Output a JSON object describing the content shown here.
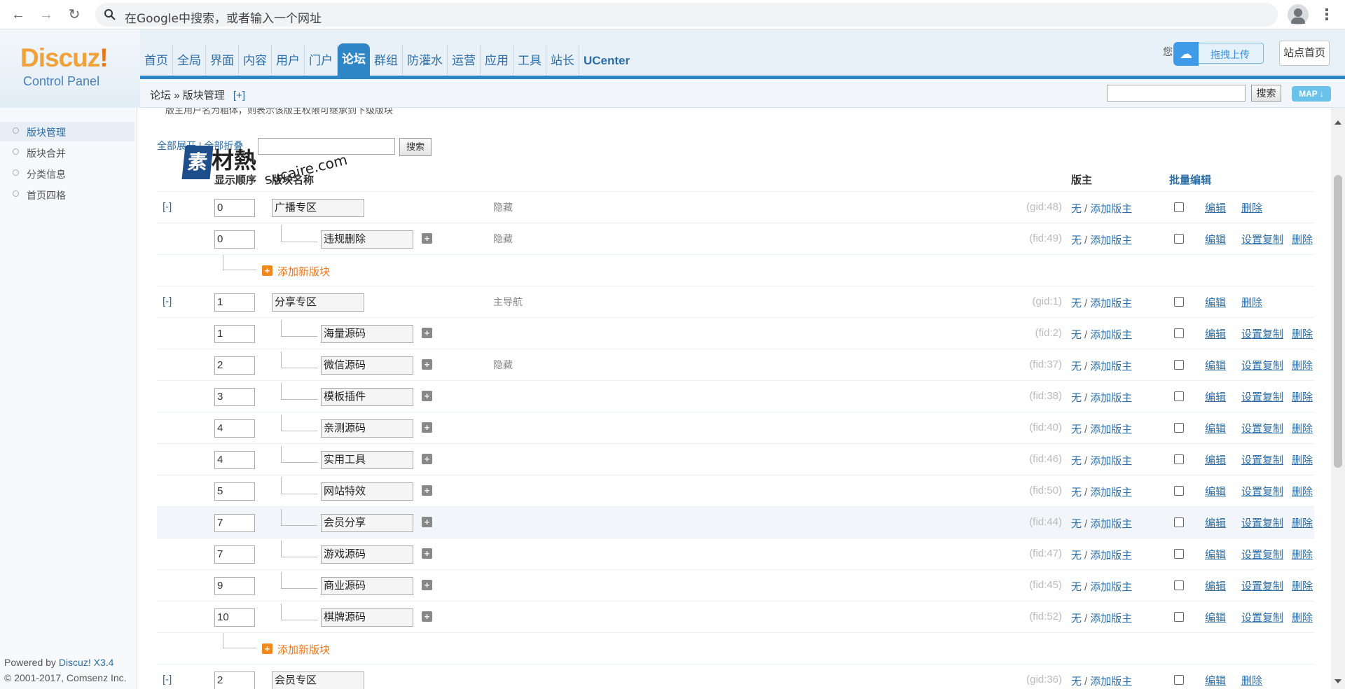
{
  "browser": {
    "back_icon": "arrow-left-icon",
    "forward_icon": "arrow-right-icon",
    "reload_icon": "reload-icon",
    "omnibox_placeholder": "在Google中搜索，或者输入一个网址"
  },
  "logo": {
    "brand_a": "Discuz",
    "brand_b": "!",
    "sub": "Control Panel"
  },
  "topnav": [
    "首页",
    "全局",
    "界面",
    "内容",
    "用户",
    "门户",
    "论坛",
    "群组",
    "防灌水",
    "运营",
    "应用",
    "工具",
    "站长",
    "UCenter"
  ],
  "topnav_active": "论坛",
  "header": {
    "user_prefix": "您",
    "upload_label": "拖拽上传",
    "site_home": "站点首页"
  },
  "breadcrumb": {
    "root": "论坛",
    "sep": "»",
    "current": "版块管理",
    "plus": "[+]"
  },
  "top_search": {
    "button": "搜索",
    "map": "MAP"
  },
  "sidebar": {
    "items": [
      "版块管理",
      "版块合并",
      "分类信息",
      "首页四格"
    ],
    "footer_line1_prefix": "Powered by ",
    "footer_line1_link": "Discuz! X3.4",
    "footer_line2": "© 2001-2017, Comsenz Inc."
  },
  "tip": "版主用户名为粗体，则表示该版主权限可继承到下级版块",
  "filter": {
    "label": "全部展开 | 全部折叠",
    "button": "搜索"
  },
  "watermark": {
    "mark": "素",
    "cn": "材熱",
    "en": "sucaire.com"
  },
  "table": {
    "headers": {
      "order": "显示顺序",
      "name": "版块名称",
      "mod": "版主",
      "batch": "批量编辑"
    },
    "mod_none": "无",
    "mod_sep": "/",
    "mod_add": "添加版主",
    "act_edit": "编辑",
    "act_copy": "设置复制",
    "act_delete": "删除",
    "add_forum": "添加新版块",
    "rows": [
      {
        "kind": "group",
        "toggle": "[-]",
        "order": "0",
        "name": "广播专区",
        "note": "隐藏",
        "id": "(gid:48)"
      },
      {
        "kind": "forum",
        "order": "0",
        "name": "违规删除",
        "note": "隐藏",
        "id": "(fid:49)"
      },
      {
        "kind": "add"
      },
      {
        "kind": "group",
        "toggle": "[-]",
        "order": "1",
        "name": "分享专区",
        "note": "主导航",
        "id": "(gid:1)"
      },
      {
        "kind": "forum",
        "order": "1",
        "name": "海量源码",
        "note": "",
        "id": "(fid:2)"
      },
      {
        "kind": "forum",
        "order": "2",
        "name": "微信源码",
        "note": "隐藏",
        "id": "(fid:37)"
      },
      {
        "kind": "forum",
        "order": "3",
        "name": "模板插件",
        "note": "",
        "id": "(fid:38)"
      },
      {
        "kind": "forum",
        "order": "4",
        "name": "亲测源码",
        "note": "",
        "id": "(fid:40)"
      },
      {
        "kind": "forum",
        "order": "4",
        "name": "实用工具",
        "note": "",
        "id": "(fid:46)"
      },
      {
        "kind": "forum",
        "order": "5",
        "name": "网站特效",
        "note": "",
        "id": "(fid:50)"
      },
      {
        "kind": "forum",
        "order": "7",
        "name": "会员分享",
        "note": "",
        "id": "(fid:44)",
        "highlight": true
      },
      {
        "kind": "forum",
        "order": "7",
        "name": "游戏源码",
        "note": "",
        "id": "(fid:47)"
      },
      {
        "kind": "forum",
        "order": "9",
        "name": "商业源码",
        "note": "",
        "id": "(fid:45)"
      },
      {
        "kind": "forum",
        "order": "10",
        "name": "棋牌源码",
        "note": "",
        "id": "(fid:52)"
      },
      {
        "kind": "add"
      },
      {
        "kind": "group",
        "toggle": "[-]",
        "order": "2",
        "name": "会员专区",
        "note": "",
        "id": "(gid:36)"
      }
    ]
  },
  "colors": {
    "accent": "#2f86c6",
    "link": "#2d6ea6",
    "brand_orange": "#f0a13a",
    "add_orange": "#e8781e"
  }
}
